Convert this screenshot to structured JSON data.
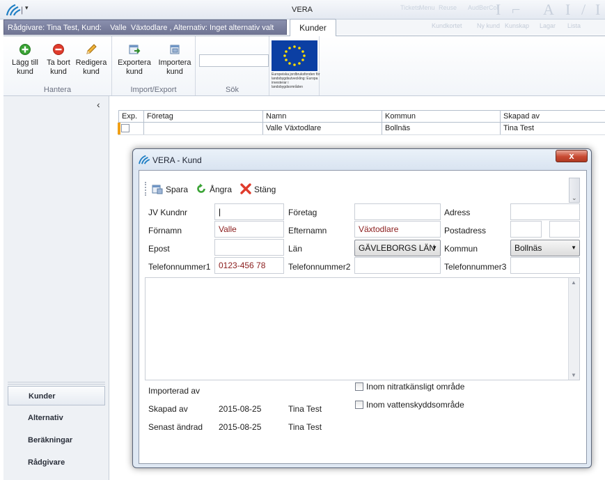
{
  "window": {
    "title": "VERA",
    "background_menu_items": [
      "Tickets",
      "Menu",
      "Reuse",
      "Kundkortet",
      "Ny kund",
      "Kunskap",
      "Lagar",
      "Lista",
      "Utför",
      "AudBerCol"
    ]
  },
  "context": {
    "text": "Rådgivare: Tina Test, Kund:    Valle  Växtodlare , Alternativ: Inget alternativ valt"
  },
  "tabs": {
    "active": "Kunder"
  },
  "ribbon": {
    "groups": {
      "hantera": {
        "label": "Hantera",
        "buttons": {
          "add": {
            "line1": "Lägg till",
            "line2": "kund",
            "icon": "add-icon"
          },
          "remove": {
            "line1": "Ta bort",
            "line2": "kund",
            "icon": "remove-icon"
          },
          "edit": {
            "line1": "Redigera",
            "line2": "kund",
            "icon": "pencil-icon"
          }
        }
      },
      "import_export": {
        "label": "Import/Export",
        "buttons": {
          "export": {
            "line1": "Exportera",
            "line2": "kund",
            "icon": "export-icon"
          },
          "import": {
            "line1": "Importera",
            "line2": "kund",
            "icon": "import-icon"
          }
        }
      },
      "search": {
        "label": "Sök",
        "value": "",
        "placeholder": ""
      }
    },
    "eu_caption": "Europeiska jordbruksfonden för landsbygdsutveckling: Europa investerar i landsbygdsområden"
  },
  "nav": {
    "items": [
      {
        "label": "Kunder",
        "active": true
      },
      {
        "label": "Alternativ",
        "active": false
      },
      {
        "label": "Beräkningar",
        "active": false
      },
      {
        "label": "Rådgivare",
        "active": false
      }
    ]
  },
  "grid": {
    "columns": [
      "Exp.",
      "Företag",
      "Namn",
      "Kommun",
      "Skapad av"
    ],
    "rows": [
      {
        "exp": false,
        "foretag": "",
        "namn": "Valle  Växtodlare",
        "kommun": "Bollnäs",
        "skapad_av": "Tina Test"
      }
    ]
  },
  "dialog": {
    "title": "VERA - Kund",
    "close_label": "x",
    "toolbar": {
      "save": "Spara",
      "undo": "Ångra",
      "close": "Stäng"
    },
    "fields": {
      "jv_kundnr": {
        "label": "JV Kundnr",
        "value": ""
      },
      "foretag": {
        "label": "Företag",
        "value": ""
      },
      "adress": {
        "label": "Adress",
        "value": ""
      },
      "fornamn": {
        "label": "Förnamn",
        "value": "Valle"
      },
      "efternamn": {
        "label": "Efternamn",
        "value": "Växtodlare"
      },
      "postadress": {
        "label": "Postadress",
        "value_zip": "",
        "value_city": ""
      },
      "epost": {
        "label": "Epost",
        "value": ""
      },
      "lan": {
        "label": "Län",
        "value": "GÄVLEBORGS LÄN"
      },
      "kommun": {
        "label": "Kommun",
        "value": "Bollnäs"
      },
      "telefon1": {
        "label": "Telefonnummer1",
        "value": "0123-456 78"
      },
      "telefon2": {
        "label": "Telefonnummer2",
        "value": ""
      },
      "telefon3": {
        "label": "Telefonnummer3",
        "value": ""
      }
    },
    "notes": "",
    "meta": {
      "importerad_av": {
        "label": "Importerad av",
        "date": "",
        "user": ""
      },
      "skapad_av": {
        "label": "Skapad av",
        "date": "2015-08-25",
        "user": "Tina Test"
      },
      "senast_andrad": {
        "label": "Senast ändrad",
        "date": "2015-08-25",
        "user": "Tina Test"
      }
    },
    "checkboxes": {
      "nitrat": {
        "label": "Inom nitratkänsligt område",
        "checked": false
      },
      "vatten": {
        "label": "Inom vattenskyddsområde",
        "checked": false
      }
    }
  },
  "colors": {
    "context_strip": "#7b7f9e",
    "active_row_marker": "#f1a016",
    "eu_blue": "#0b3fa3",
    "eu_stars": "#ffdd00",
    "close_red": "#c84a32",
    "field_value": "#8a1c1c"
  }
}
